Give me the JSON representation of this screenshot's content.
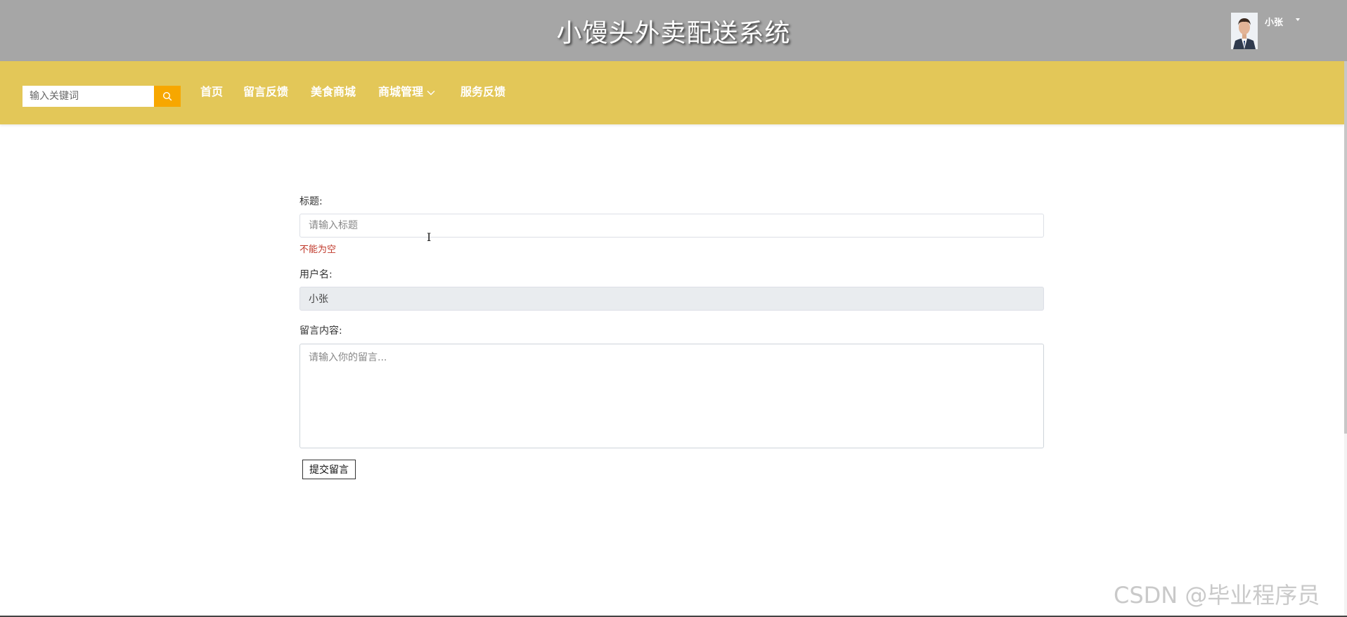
{
  "header": {
    "title": "小馒头外卖配送系统",
    "username": "小张",
    "avatar_icon": "user-avatar-icon",
    "dropdown_icon": "caret-down-icon"
  },
  "nav": {
    "search_placeholder": "输入关键词",
    "search_icon": "search-icon",
    "items": [
      {
        "label": "首页"
      },
      {
        "label": "留言反馈"
      },
      {
        "label": "美食商城"
      },
      {
        "label": "商城管理"
      },
      {
        "label": "服务反馈"
      }
    ]
  },
  "form": {
    "title_label": "标题:",
    "title_placeholder": "请输入标题",
    "title_error": "不能为空",
    "username_label": "用户名:",
    "username_value": "小张",
    "content_label": "留言内容:",
    "content_placeholder": "请输入你的留言...",
    "submit_label": "提交留言"
  },
  "watermark": "CSDN @毕业程序员",
  "colors": {
    "header_bg": "#a6a6a6",
    "nav_bg": "#e3c758",
    "search_button": "#f7a700",
    "error": "#c0392b"
  }
}
